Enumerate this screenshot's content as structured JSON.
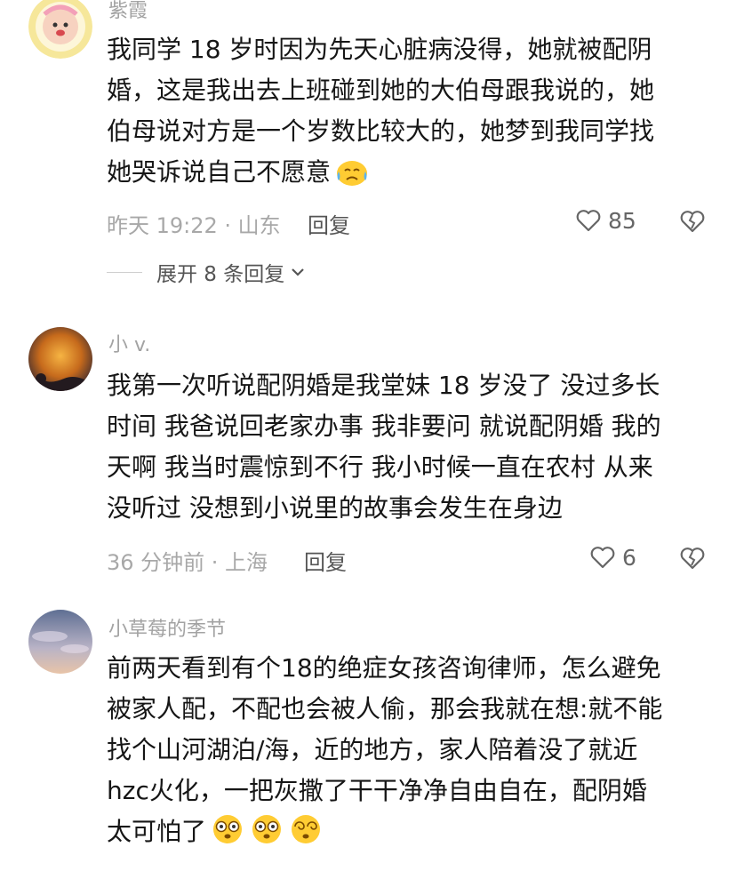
{
  "comments": [
    {
      "username": "紫霞",
      "body_lines": [
        "我同学 18 岁时因为先天心脏病没得，她就被配阴",
        "婚，这是我出去上班碰到她的大伯母跟我说的，她",
        "伯母说对方是一个岁数比较大的，她梦到我同学找",
        "她哭诉说自己不愿意"
      ],
      "meta": "昨天 19:22 · 山东",
      "reply_label": "回复",
      "likes": "85",
      "expand_label": "展开 8 条回复"
    },
    {
      "username": "小 v.",
      "body_lines": [
        "我第一次听说配阴婚是我堂妹 18 岁没了 没过多长",
        "时间 我爸说回老家办事 我非要问 就说配阴婚 我的",
        "天啊 我当时震惊到不行 我小时候一直在农村 从来",
        "没听过 没想到小说里的故事会发生在身边"
      ],
      "meta": "36 分钟前 · 上海",
      "reply_label": "回复",
      "likes": "6"
    },
    {
      "username": "小草莓的季节",
      "body_lines": [
        "前两天看到有个18的绝症女孩咨询律师，怎么避免",
        "被家人配，不配也会被人偷，那会我就在想:就不能",
        "找个山河湖泊/海，近的地方，家人陪着没了就近",
        "hzc火化，一把灰撒了干干净净自由自在，配阴婚",
        "太可怕了"
      ]
    }
  ],
  "colors": {
    "text": "#161616",
    "meta": "#a8a8a8",
    "accent_like": "#666666"
  },
  "icons": [
    "heart-icon",
    "broken-heart-icon",
    "chevron-down-icon",
    "crying-emoji-icon",
    "dizzy-emoji-icon"
  ]
}
